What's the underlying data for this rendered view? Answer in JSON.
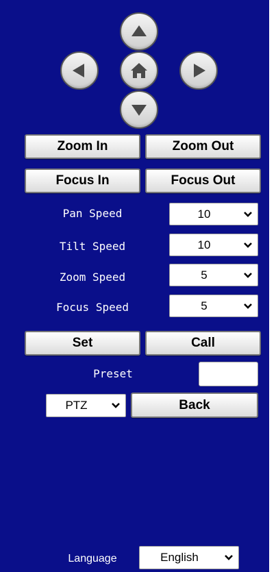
{
  "ptz_pad": {
    "up_icon": "arrow-up-icon",
    "left_icon": "arrow-left-icon",
    "home_icon": "home-icon",
    "right_icon": "arrow-right-icon",
    "down_icon": "arrow-down-icon"
  },
  "zoom": {
    "in_label": "Zoom In",
    "out_label": "Zoom Out"
  },
  "focus": {
    "in_label": "Focus In",
    "out_label": "Focus Out"
  },
  "speeds": {
    "pan": {
      "label": "Pan Speed",
      "value": "10"
    },
    "tilt": {
      "label": "Tilt Speed",
      "value": "10"
    },
    "zoom": {
      "label": "Zoom Speed",
      "value": "5"
    },
    "focus": {
      "label": "Focus Speed",
      "value": "5"
    }
  },
  "preset": {
    "set_label": "Set",
    "call_label": "Call",
    "label": "Preset",
    "value": ""
  },
  "mode": {
    "value": "PTZ",
    "back_label": "Back"
  },
  "language": {
    "label": "Language",
    "value": "English"
  },
  "colors": {
    "panel": "#0a0f8a",
    "button": "#e6e6e6",
    "text": "#ffffff"
  }
}
